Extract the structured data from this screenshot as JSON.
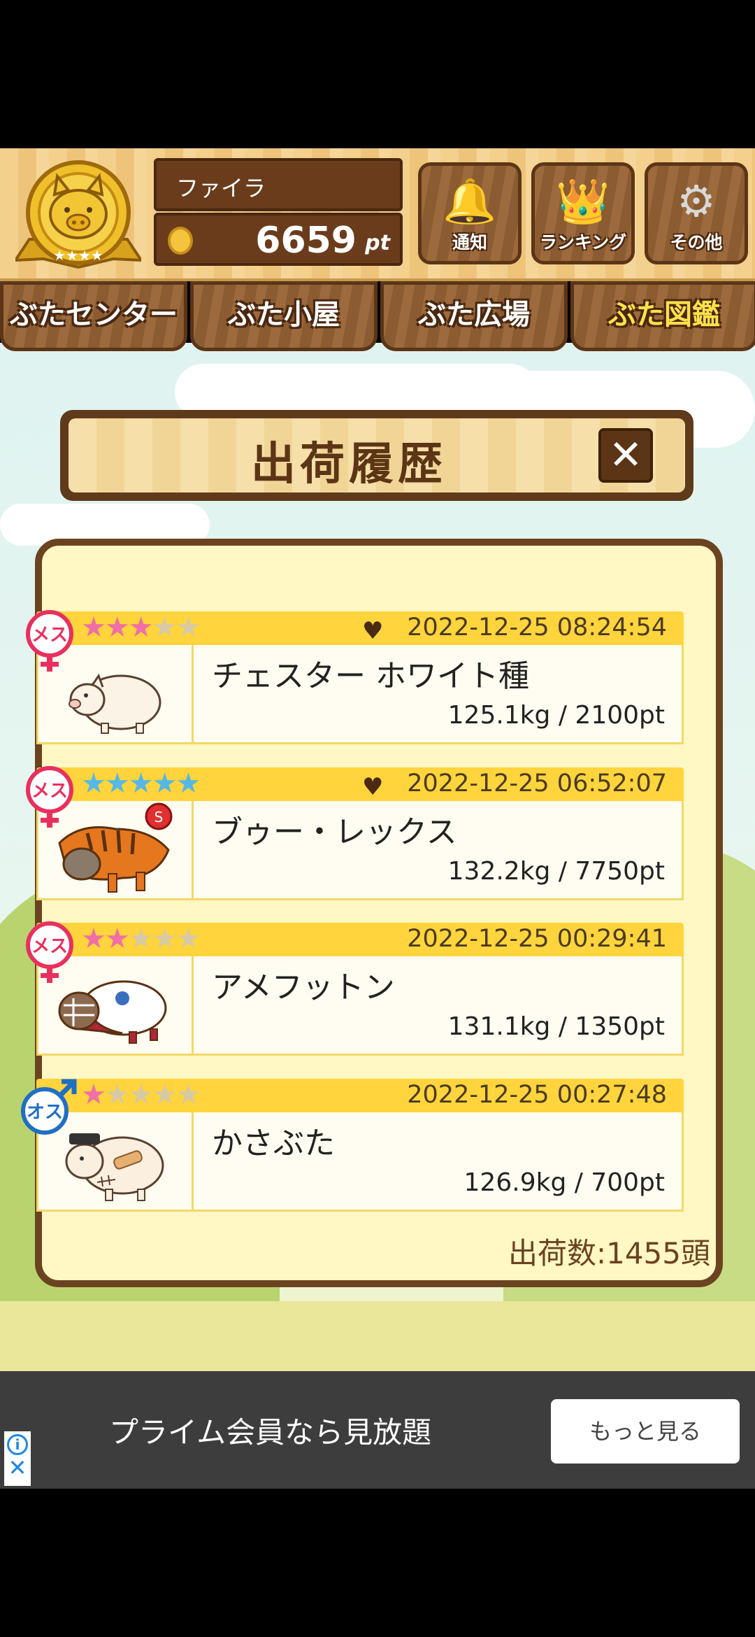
{
  "header": {
    "player_name": "ファイラ",
    "points": "6659",
    "points_unit": "pt",
    "buttons": [
      {
        "label": "通知",
        "icon": "bell-icon",
        "glyph": "🔔"
      },
      {
        "label": "ランキング",
        "icon": "crown-icon",
        "glyph": "👑"
      },
      {
        "label": "その他",
        "icon": "gear-icon",
        "glyph": "⚙"
      }
    ]
  },
  "tabs": [
    {
      "label": "ぶたセンター",
      "active": false
    },
    {
      "label": "ぶた小屋",
      "active": false
    },
    {
      "label": "ぶた広場",
      "active": false
    },
    {
      "label": "ぶた図鑑",
      "active": true
    }
  ],
  "dialog": {
    "title": "出荷履歴",
    "close_label": "✕",
    "entries": [
      {
        "gender": "メス",
        "stars": 3,
        "star_color": "#ef6fa6",
        "favorite": true,
        "date": "2022-12-25 08:24:54",
        "name": "チェスター ホワイト種",
        "weight": "125.1kg / 2100pt",
        "pig": "white-pig"
      },
      {
        "gender": "メス",
        "stars": 5,
        "star_color": "#55b8e6",
        "favorite": true,
        "date": "2022-12-25 06:52:07",
        "name": "ブゥー・レックス",
        "weight": "132.2kg / 7750pt",
        "pig": "trex-pig"
      },
      {
        "gender": "メス",
        "stars": 2,
        "star_color": "#ef6fa6",
        "favorite": false,
        "date": "2022-12-25 00:29:41",
        "name": "アメフットン",
        "weight": "131.1kg / 1350pt",
        "pig": "football-pig"
      },
      {
        "gender": "オス",
        "stars": 1,
        "star_color": "#ef6fa6",
        "favorite": false,
        "date": "2022-12-25 00:27:48",
        "name": "かさぶた",
        "weight": "126.9kg / 700pt",
        "pig": "bandage-pig"
      }
    ],
    "shipment_count": "出荷数:1455頭"
  },
  "ad": {
    "text": "プライム会員なら見放題",
    "button": "もっと見る",
    "info_icon": "info-icon",
    "close_icon": "close-icon"
  },
  "colors": {
    "wood_dark": "#5b3516",
    "panel_bg": "#fff7c4",
    "bar_yellow": "#ffd43c",
    "female": "#e8305f",
    "male": "#1f6fc4"
  }
}
